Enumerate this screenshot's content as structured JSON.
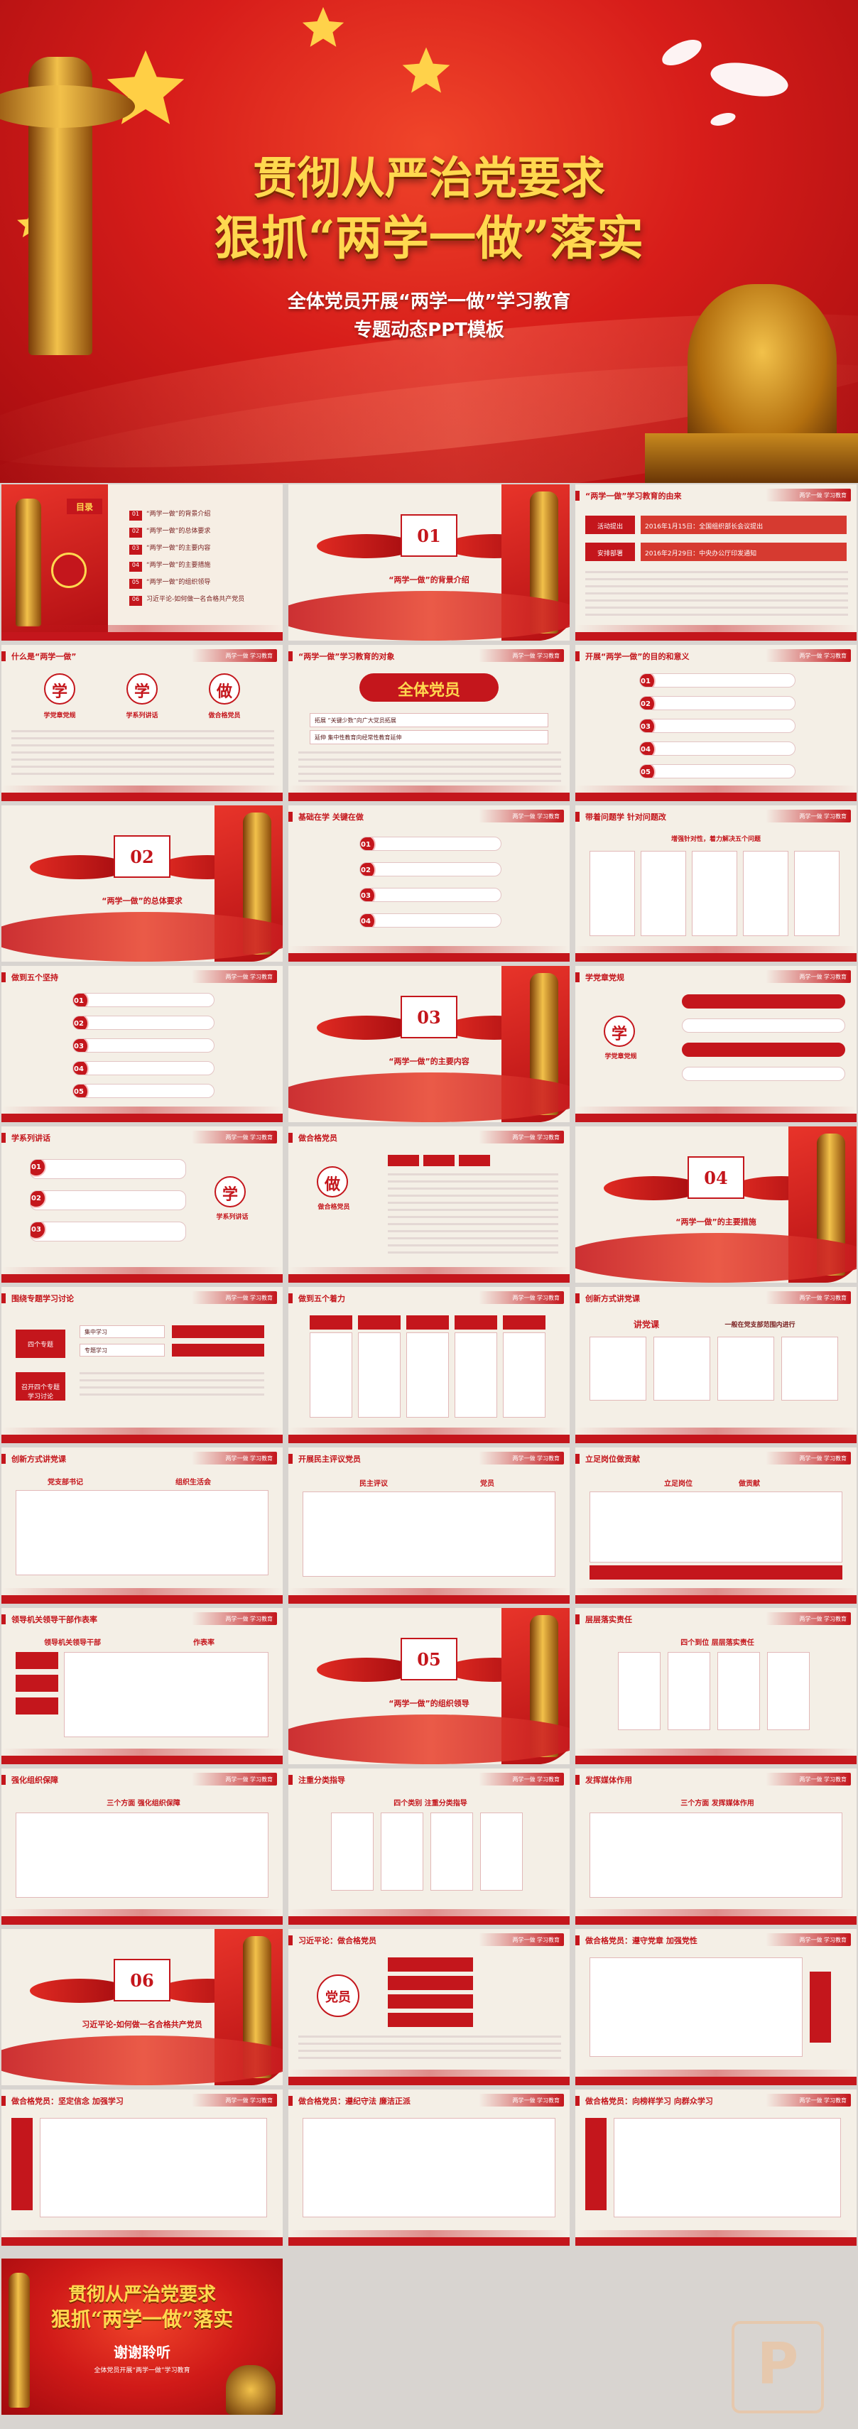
{
  "hero": {
    "title1": "贯彻从严治党要求",
    "title2": "狠抓“两学一做”落实",
    "sub1": "全体党员开展“两学一做”学习教育",
    "sub2": "专题动态PPT模板"
  },
  "common": {
    "banner": "两学一做 学习教育"
  },
  "slides": {
    "toc": {
      "label": "目录",
      "items": [
        {
          "num": "01",
          "text": "“两学一做”的背景介绍"
        },
        {
          "num": "02",
          "text": "“两学一做”的总体要求"
        },
        {
          "num": "03",
          "text": "“两学一做”的主要内容"
        },
        {
          "num": "04",
          "text": "“两学一做”的主要措施"
        },
        {
          "num": "05",
          "text": "“两学一做”的组织领导"
        },
        {
          "num": "06",
          "text": "习近平论-如何做一名合格共产党员"
        }
      ]
    },
    "sec1": {
      "num": "01",
      "title": "“两学一做”的背景介绍"
    },
    "origin": {
      "header": "“两学一做”学习教育的由来",
      "rows": [
        {
          "label": "活动提出",
          "text": "2016年1月15日：全国组织部长会议提出"
        },
        {
          "label": "安排部署",
          "text": "2016年2月29日：中央办公厅印发通知"
        }
      ]
    },
    "what": {
      "header": "什么是“两学一做”",
      "chars": [
        "学",
        "学",
        "做"
      ],
      "labels": [
        "学党章党规",
        "学系列讲话",
        "做合格党员"
      ]
    },
    "target": {
      "header": "“两学一做”学习教育的对象",
      "title": "全体党员",
      "rows": [
        "拓展  “关键少数”向广大党员拓展",
        "延伸  集中性教育向经常性教育延伸"
      ]
    },
    "purpose": {
      "header": "开展“两学一做”的目的和意义",
      "items": [
        "01",
        "02",
        "03",
        "04",
        "05"
      ]
    },
    "sec2": {
      "num": "02",
      "title": "“两学一做”的总体要求"
    },
    "basic": {
      "header": "基础在学 关键在做",
      "items": [
        "01",
        "02",
        "03",
        "04"
      ]
    },
    "problem": {
      "header": "带着问题学 针对问题改",
      "top": "增强针对性，着力解决五个问题"
    },
    "five": {
      "header": "做到五个坚持",
      "items": [
        "01",
        "02",
        "03",
        "04",
        "05"
      ]
    },
    "sec3": {
      "num": "03",
      "title": "“两学一做”的主要内容"
    },
    "rules": {
      "header": "学党章党规",
      "char": "学",
      "label": "学党章党规"
    },
    "speech": {
      "header": "学系列讲话",
      "char": "学",
      "label": "学系列讲话",
      "items": [
        "01",
        "02",
        "03"
      ]
    },
    "qualified": {
      "header": "做合格党员",
      "char": "做",
      "label": "做合格党员"
    },
    "sec4": {
      "num": "04",
      "title": "“两学一做”的主要措施"
    },
    "topic": {
      "header": "围绕专题学习讨论",
      "boxes": [
        "集中学习",
        "专题学习",
        "四个专题"
      ],
      "left": [
        "召开四个专题学习讨论"
      ]
    },
    "lecture": {
      "header": "创新方式讲党课",
      "title": "讲党课",
      "sub": "一般在党支部范围内进行"
    },
    "lesson": {
      "header": "创新方式讲党课",
      "cols": [
        "党支部书记",
        "组织生活会"
      ]
    },
    "dem": {
      "header": "开展民主评议党员",
      "cols": [
        "民主评议",
        "党员"
      ]
    },
    "pos": {
      "header": "立足岗位做贡献",
      "cols": [
        "立足岗位",
        "做贡献"
      ]
    },
    "lead": {
      "header": "领导机关领导干部作表率",
      "cols": [
        "领导机关领导干部",
        "作表率"
      ]
    },
    "sec5": {
      "num": "05",
      "title": "“两学一做”的组织领导"
    },
    "resp": {
      "header": "层层落实责任",
      "title": "四个到位  层层落实责任"
    },
    "guide": {
      "header": "强化组织保障",
      "title": "三个方面  强化组织保障"
    },
    "class": {
      "header": "注重分类指导",
      "title": "四个类别  注重分类指导"
    },
    "media": {
      "header": "发挥媒体作用",
      "title": "三个方面  发挥媒体作用"
    },
    "sec6": {
      "num": "06",
      "title": "习近平论-如何做一名合格共产党员"
    },
    "xi1": {
      "header": "习近平论：做合格党员",
      "label": "党员"
    },
    "xi2": {
      "header": "做合格党员：遵守党章 加强党性"
    },
    "xi3": {
      "header": "做合格党员：坚定信念 加强学习"
    },
    "xi4": {
      "header": "做合格党员：遵纪守法 廉洁正派"
    },
    "xi5": {
      "header": "做合格党员：向榜样学习 向群众学习"
    },
    "closing": {
      "title1": "贯彻从严治党要求",
      "title2": "狠抓“两学一做”落实",
      "thanks": "谢谢聆听",
      "sub": "全体党员开展“两学一做”学习教育"
    }
  },
  "colors": {
    "primary": "#c4161c",
    "gold": "#ffd84f",
    "paper": "#f4efe6"
  }
}
